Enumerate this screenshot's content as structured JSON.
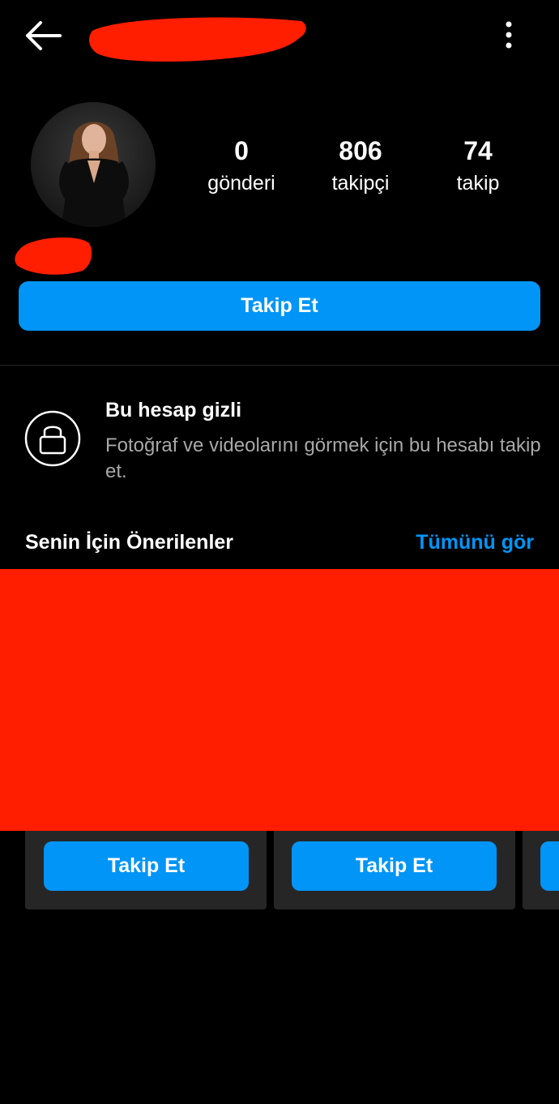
{
  "header": {
    "back_icon": "arrow-left-icon",
    "more_icon": "more-vertical-icon"
  },
  "profile": {
    "avatar_icon": "profile-photo",
    "stats": [
      {
        "value": "0",
        "label": "gönderi"
      },
      {
        "value": "806",
        "label": "takipçi"
      },
      {
        "value": "74",
        "label": "takip"
      }
    ],
    "follow_label": "Takip Et"
  },
  "private_notice": {
    "icon": "lock-icon",
    "title": "Bu hesap gizli",
    "description": "Fotoğraf ve videolarını görmek için bu hesabı takip et."
  },
  "suggestions": {
    "title": "Senin İçin Önerilenler",
    "see_all": "Tümünü gör",
    "cards": [
      {
        "follow_label": "Takip Et"
      },
      {
        "follow_label": "Takip Et"
      }
    ]
  },
  "colors": {
    "background": "#000000",
    "accent": "#0095f6",
    "secondary_text": "#a8a8a8",
    "card": "#262626",
    "redaction": "#ff1e00"
  }
}
